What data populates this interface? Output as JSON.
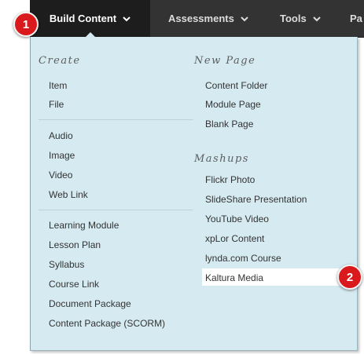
{
  "nav": {
    "build_content": "Build Content",
    "assessments": "Assessments",
    "tools": "Tools",
    "partner": "Pa"
  },
  "badges": {
    "first": "1",
    "second": "2"
  },
  "menu": {
    "create_heading": "Create",
    "create_items": [
      "Item",
      "File",
      "Audio",
      "Image",
      "Video",
      "Web Link",
      "Learning Module",
      "Lesson Plan",
      "Syllabus",
      "Course Link",
      "Document Package",
      "Content Package (SCORM)"
    ],
    "new_page_heading": "New Page",
    "new_page_items": [
      "Content Folder",
      "Module Page",
      "Blank Page"
    ],
    "mashups_heading": "Mashups",
    "mashups_items": [
      "Flickr Photo",
      "SlideShare Presentation",
      "YouTube Video",
      "xpLor Content",
      "lynda.com Course",
      "Kaltura Media"
    ]
  },
  "icons": {
    "dropdown": "chevron-down-icon"
  },
  "colors": {
    "nav_bg": "#333333",
    "nav_active_bg": "#1d1d1d",
    "menu_bg": "#d5eaf1",
    "badge": "#d9191c",
    "highlight": "#ffffff"
  }
}
